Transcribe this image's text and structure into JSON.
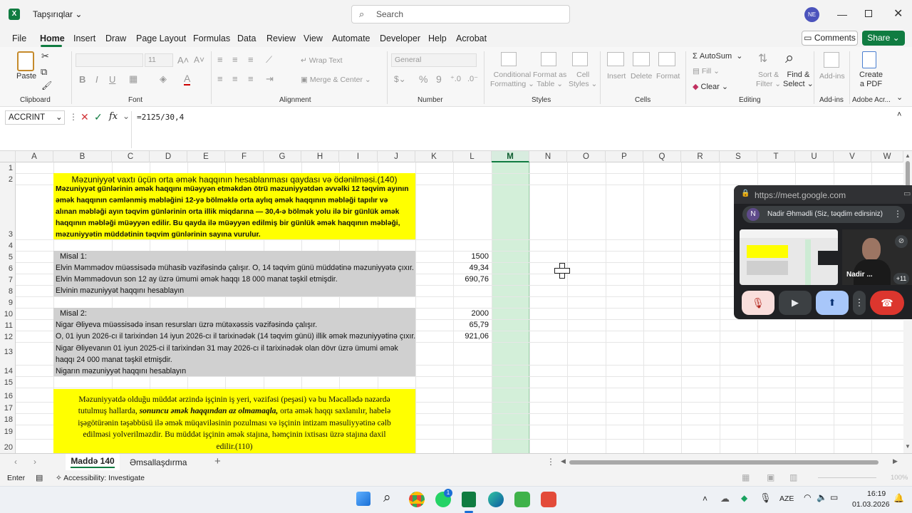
{
  "window": {
    "title": "Tapşırıqlar",
    "search_placeholder": "Search",
    "user_initials": "NE",
    "accent": "#107c41"
  },
  "menu": [
    "File",
    "Home",
    "Insert",
    "Draw",
    "Page Layout",
    "Formulas",
    "Data",
    "Review",
    "View",
    "Automate",
    "Developer",
    "Help",
    "Acrobat"
  ],
  "menu_active": "Home",
  "actions": {
    "comments": "Comments",
    "share": "Share"
  },
  "ribbon": {
    "clipboard": {
      "paste": "Paste",
      "label": "Clipboard"
    },
    "font": {
      "size": "11",
      "label": "Font"
    },
    "alignment": {
      "wrap": "Wrap Text",
      "merge": "Merge & Center",
      "label": "Alignment"
    },
    "number": {
      "format": "General",
      "label": "Number"
    },
    "styles": {
      "conditional1": "Conditional",
      "conditional2": "Formatting",
      "format_table1": "Format as",
      "format_table2": "Table",
      "cell_styles1": "Cell",
      "cell_styles2": "Styles",
      "label": "Styles"
    },
    "cells": {
      "insert": "Insert",
      "delete": "Delete",
      "format": "Format",
      "label": "Cells"
    },
    "editing": {
      "autosum": "AutoSum",
      "fill": "Fill",
      "clear": "Clear",
      "sort1": "Sort &",
      "sort2": "Filter",
      "find1": "Find &",
      "find2": "Select",
      "label": "Editing"
    },
    "addins": {
      "addins": "Add-ins",
      "label": "Add-ins"
    },
    "adobe": {
      "create1": "Create",
      "create2": "a PDF",
      "label": "Adobe Acr..."
    }
  },
  "formula_bar": {
    "name_box": "ACCRINT",
    "fx": "fx",
    "formula": "=2125/30,4"
  },
  "columns": [
    "A",
    "B",
    "C",
    "D",
    "E",
    "F",
    "G",
    "H",
    "I",
    "J",
    "K",
    "L",
    "M",
    "N",
    "O",
    "P",
    "Q",
    "R",
    "S",
    "T",
    "U",
    "V",
    "W"
  ],
  "rows": [
    "1",
    "2",
    "3",
    "4",
    "5",
    "6",
    "7",
    "8",
    "9",
    "10",
    "11",
    "12",
    "13",
    "14",
    "15",
    "16",
    "17",
    "18",
    "19",
    "20"
  ],
  "sheet": {
    "title": "Məzuniyyət vaxtı üçün orta əmək haqqının hesablanması qaydası və ödənilməsi.(140)",
    "desc_lines": [
      "Məzuniyyət günlərinin əmək haqqını müəyyən etməkdən ötrü məzuniyyətdən əvvəlki 12 təqvim ayının",
      "əmək haqqının cəmlənmiş məbləğini 12-yə bölməklə orta aylıq əmək haqqının məbləği tapılır və",
      "alınan məbləği ayın təqvim günlərinin orta illik miqdarına — 30,4-ə bölmək yolu ilə bir günlük əmək",
      "haqqının məbləği müəyyən edilir. Bu qayda ilə müəyyən edilmiş bir günlük əmək haqqının məbləği,",
      "məzuniyyətin müddətinin təqvim günlərinin sayına vurulur."
    ],
    "ex1": {
      "title": "Misal 1:",
      "lines": [
        "Elvin Məmmədov müəssisədə mühasib vəzifəsində çalışır. O, 14 təqvim günü müddətinə məzuniyyətə çıxır.",
        "Elvin Məmmədovun son 12 ay üzrə ümumi əmək haqqı 18 000 manat təşkil etmişdir.",
        "Elvinin məzuniyyət haqqını hesablayın"
      ],
      "values": [
        "1500",
        "49,34",
        "690,76"
      ]
    },
    "ex2": {
      "title": "Misal 2:",
      "lines": [
        "Nigar Əliyeva müəssisədə insan resursları üzrə mütəxəssis vəzifəsində çalışır.",
        "O, 01 iyun 2026-cı il tarixindən 14 iyun 2026-cı il tarixinədək (14 təqvim günü) illik əmək məzuniyyətinə çıxır.",
        "Nigar Əliyevanın 01 iyun 2025-ci il tarixindən 31 may 2026-cı il tarixinədək olan dövr üzrə ümumi əmək",
        "haqqı 24 000 manat təşkil etmişdir.",
        "Nigarın məzuniyyət haqqını hesablayın"
      ],
      "values": [
        "2000",
        "65,79",
        "921,06"
      ]
    },
    "note_lines": [
      "Məzuniyyətdə olduğu müddət ərzində işçinin iş yeri, vəzifəsi (peşəsi) və bu Məcəllədə nəzərdə",
      "tutulmuş hallarda,",
      "sonuncu əmək haqqından az olmamaqla,",
      "orta əmək haqqı saxlanılır, habelə",
      "işəgötürənin təşəbbüsü ilə əmək müqaviləsinin pozulması və işçinin intizam məsuliyyətinə cəlb",
      "edilməsi yolverilməzdir. Bu müddət işçinin əmək stajına, həmçinin ixtisası üzrə stajına daxil",
      "edilir.(110)"
    ]
  },
  "tabs": [
    "Maddə 140",
    "Əmsallaşdırma"
  ],
  "status": {
    "mode": "Enter",
    "accessibility": "Accessibility: Investigate",
    "zoom": "100%"
  },
  "meet": {
    "url": "https://meet.google.com",
    "presenter": "Nadir Əhmədli (Siz, təqdim edirsiniz)",
    "avatar": "N",
    "tile_name": "Nadir ...",
    "more": "+11"
  },
  "taskbar": {
    "lang": "AZE",
    "time": "16:19",
    "date": "01.03.2026",
    "badge": "1"
  }
}
